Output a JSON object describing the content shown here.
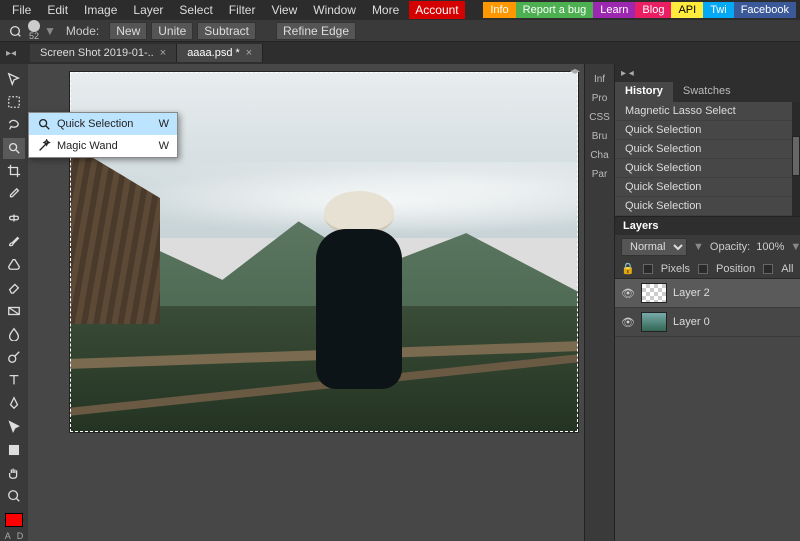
{
  "menubar": {
    "items": [
      "File",
      "Edit",
      "Image",
      "Layer",
      "Select",
      "Filter",
      "View",
      "Window",
      "More"
    ],
    "account": "Account",
    "ext": {
      "info": "Info",
      "bug": "Report a bug",
      "learn": "Learn",
      "blog": "Blog",
      "api": "API",
      "twi": "Twi",
      "fb": "Facebook"
    }
  },
  "optionsbar": {
    "brush_size": "52",
    "mode_label": "Mode:",
    "mode_options": [
      "New",
      "Unite",
      "Subtract"
    ],
    "refine": "Refine Edge"
  },
  "tabs": [
    {
      "label": "Screen Shot 2019-01-..",
      "active": false
    },
    {
      "label": "aaaa.psd *",
      "active": true
    }
  ],
  "flyout": {
    "items": [
      {
        "label": "Quick Selection",
        "shortcut": "W",
        "active": true,
        "icon": "quick-selection-icon"
      },
      {
        "label": "Magic Wand",
        "shortcut": "W",
        "active": false,
        "icon": "magic-wand-icon"
      }
    ]
  },
  "rightstrip": {
    "labels": [
      "Inf",
      "Pro",
      "CSS",
      "Bru",
      "Cha",
      "Par"
    ]
  },
  "history": {
    "tabs": [
      {
        "label": "History",
        "active": true
      },
      {
        "label": "Swatches",
        "active": false
      }
    ],
    "items": [
      "Magnetic Lasso Select",
      "Quick Selection",
      "Quick Selection",
      "Quick Selection",
      "Quick Selection",
      "Quick Selection"
    ]
  },
  "layers": {
    "title": "Layers",
    "blend": "Normal",
    "opacity_label": "Opacity:",
    "opacity_value": "100%",
    "locks": {
      "pixels": "Pixels",
      "position": "Position",
      "all": "All"
    },
    "items": [
      {
        "name": "Layer 2",
        "selected": true,
        "thumb": "checker"
      },
      {
        "name": "Layer 0",
        "selected": false,
        "thumb": "img"
      }
    ]
  },
  "swatch_labels": {
    "a": "A",
    "d": "D"
  }
}
